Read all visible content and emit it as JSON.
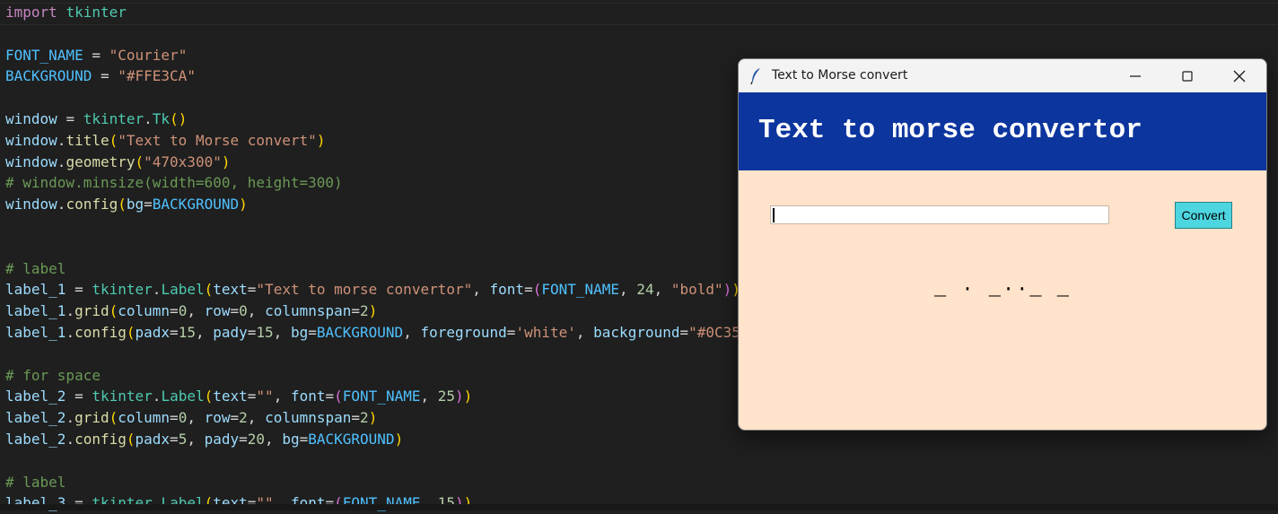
{
  "editor": {
    "lines": [
      "import tkinter",
      "",
      "FONT_NAME = \"Courier\"",
      "BACKGROUND = \"#FFE3CA\"",
      "",
      "window = tkinter.Tk()",
      "window.title(\"Text to Morse convert\")",
      "window.geometry(\"470x300\")",
      "# window.minsize(width=600, height=300)",
      "window.config(bg=BACKGROUND)",
      "",
      "",
      "# label",
      "label_1 = tkinter.Label(text=\"Text to morse convertor\", font=(FONT_NAME, 24, \"bold\"))",
      "label_1.grid(column=0, row=0, columnspan=2)",
      "label_1.config(padx=15, pady=15, bg=BACKGROUND, foreground='white', background=\"#0C35",
      "",
      "# for space",
      "label_2 = tkinter.Label(text=\"\", font=(FONT_NAME, 25))",
      "label_2.grid(column=0, row=2, columnspan=2)",
      "label_2.config(padx=5, pady=20, bg=BACKGROUND)",
      "",
      "# label",
      "label_3 = tkinter.Label(text=\"\", font=(FONT_NAME, 15))"
    ]
  },
  "tk_window": {
    "title": "Text to Morse convert",
    "header_text": "Text to morse convertor",
    "entry_value": "",
    "button_label": "Convert",
    "morse_output": "_ · _··_ _",
    "colors": {
      "background": "#FFE3CA",
      "header_bg": "#0C359E",
      "header_fg": "#FFFFFF",
      "button_bg": "#4DD6E0"
    }
  },
  "icons": {
    "app": "feather-icon",
    "minimize": "minimize-icon",
    "maximize": "maximize-icon",
    "close": "close-icon"
  }
}
